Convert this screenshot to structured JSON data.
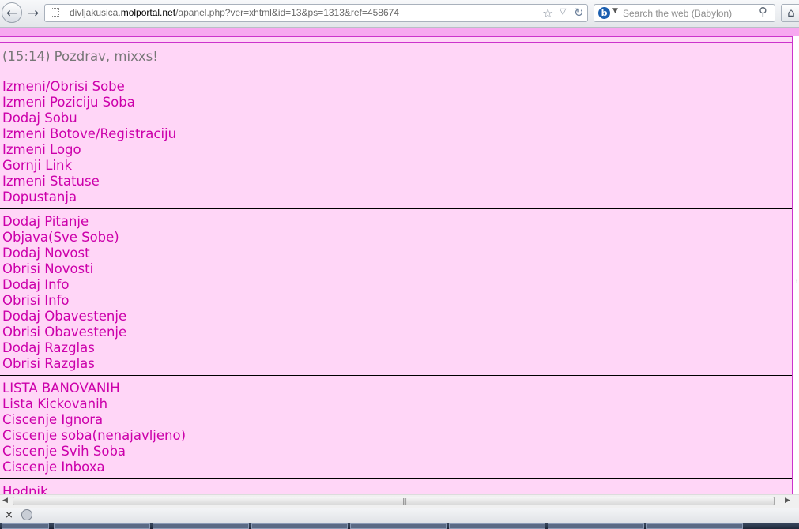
{
  "browser": {
    "url_prefix": "divljakusica.",
    "url_host": "molportal.net",
    "url_path": "/apanel.php?ver=xhtml&id=13&ps=1313&ref=458674",
    "search_placeholder": "Search the web (Babylon)",
    "search_engine_letter": "b",
    "back_icon": "←",
    "forward_icon": "→",
    "star_icon": "☆",
    "dropdown_icon": "▽",
    "reload_icon": "↻",
    "search_icon": "⚲",
    "home_icon": "⌂"
  },
  "page": {
    "greeting": "(15:14) Pozdrav, mixxs!",
    "colors": {
      "panel_bg": "#ffd6f7",
      "border": "#cc33cc",
      "link": "#cc00aa",
      "top_strip": "#f7a8f0"
    },
    "groups": [
      {
        "items": [
          "Izmeni/Obrisi Sobe",
          "Izmeni Poziciju Soba",
          "Dodaj Sobu",
          "Izmeni Botove/Registraciju",
          "Izmeni Logo",
          "Gornji Link",
          "Izmeni Statuse",
          "Dopustanja"
        ]
      },
      {
        "items": [
          "Dodaj Pitanje",
          "Objava(Sve Sobe)",
          "Dodaj Novost",
          "Obrisi Novosti",
          "Dodaj Info",
          "Obrisi Info",
          "Dodaj Obavestenje",
          "Obrisi Obavestenje",
          "Dodaj Razglas",
          "Obrisi Razglas"
        ]
      },
      {
        "items": [
          "LISTA BANOVANIH",
          "Lista Kickovanih",
          "Ciscenje Ignora",
          "Ciscenje soba(nenajavljeno)",
          "Ciscenje Svih Soba",
          "Ciscenje Inboxa"
        ]
      },
      {
        "items": [
          "Hodnik"
        ]
      }
    ]
  },
  "statusbar": {
    "close_icon": "×"
  }
}
